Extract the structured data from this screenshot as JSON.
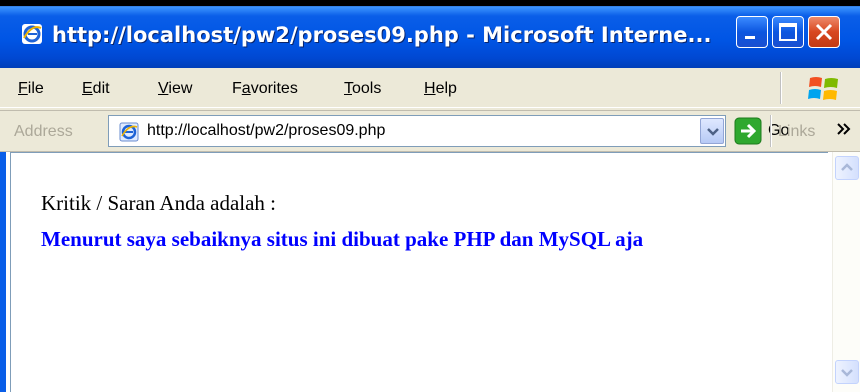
{
  "window": {
    "title": "http://localhost/pw2/proses09.php - Microsoft Interne...",
    "accent": "#0a5ee8",
    "close_color": "#d84820"
  },
  "menu": {
    "items": [
      {
        "id": "file",
        "accel": "F",
        "rest": "ile"
      },
      {
        "id": "edit",
        "accel": "E",
        "rest": "dit"
      },
      {
        "id": "view",
        "accel": "V",
        "rest": "iew"
      },
      {
        "id": "favorites",
        "pre": "F",
        "accel": "a",
        "rest": "vorites"
      },
      {
        "id": "tools",
        "accel": "T",
        "rest": "ools"
      },
      {
        "id": "help",
        "accel": "H",
        "rest": "elp"
      }
    ]
  },
  "addressbar": {
    "label": "Address",
    "url": "http://localhost/pw2/proses09.php",
    "go_label": "Go",
    "links_label": "Links",
    "icons": {
      "page": "ie-page-icon",
      "dropdown": "chevron-down-icon",
      "go": "go-arrow-icon",
      "links": "chevron-right-double-icon"
    }
  },
  "content": {
    "label": "Kritik / Saran Anda adalah :",
    "message": "Menurut saya sebaiknya situs ini dibuat pake PHP dan MySQL aja",
    "message_color": "#0000ff"
  }
}
